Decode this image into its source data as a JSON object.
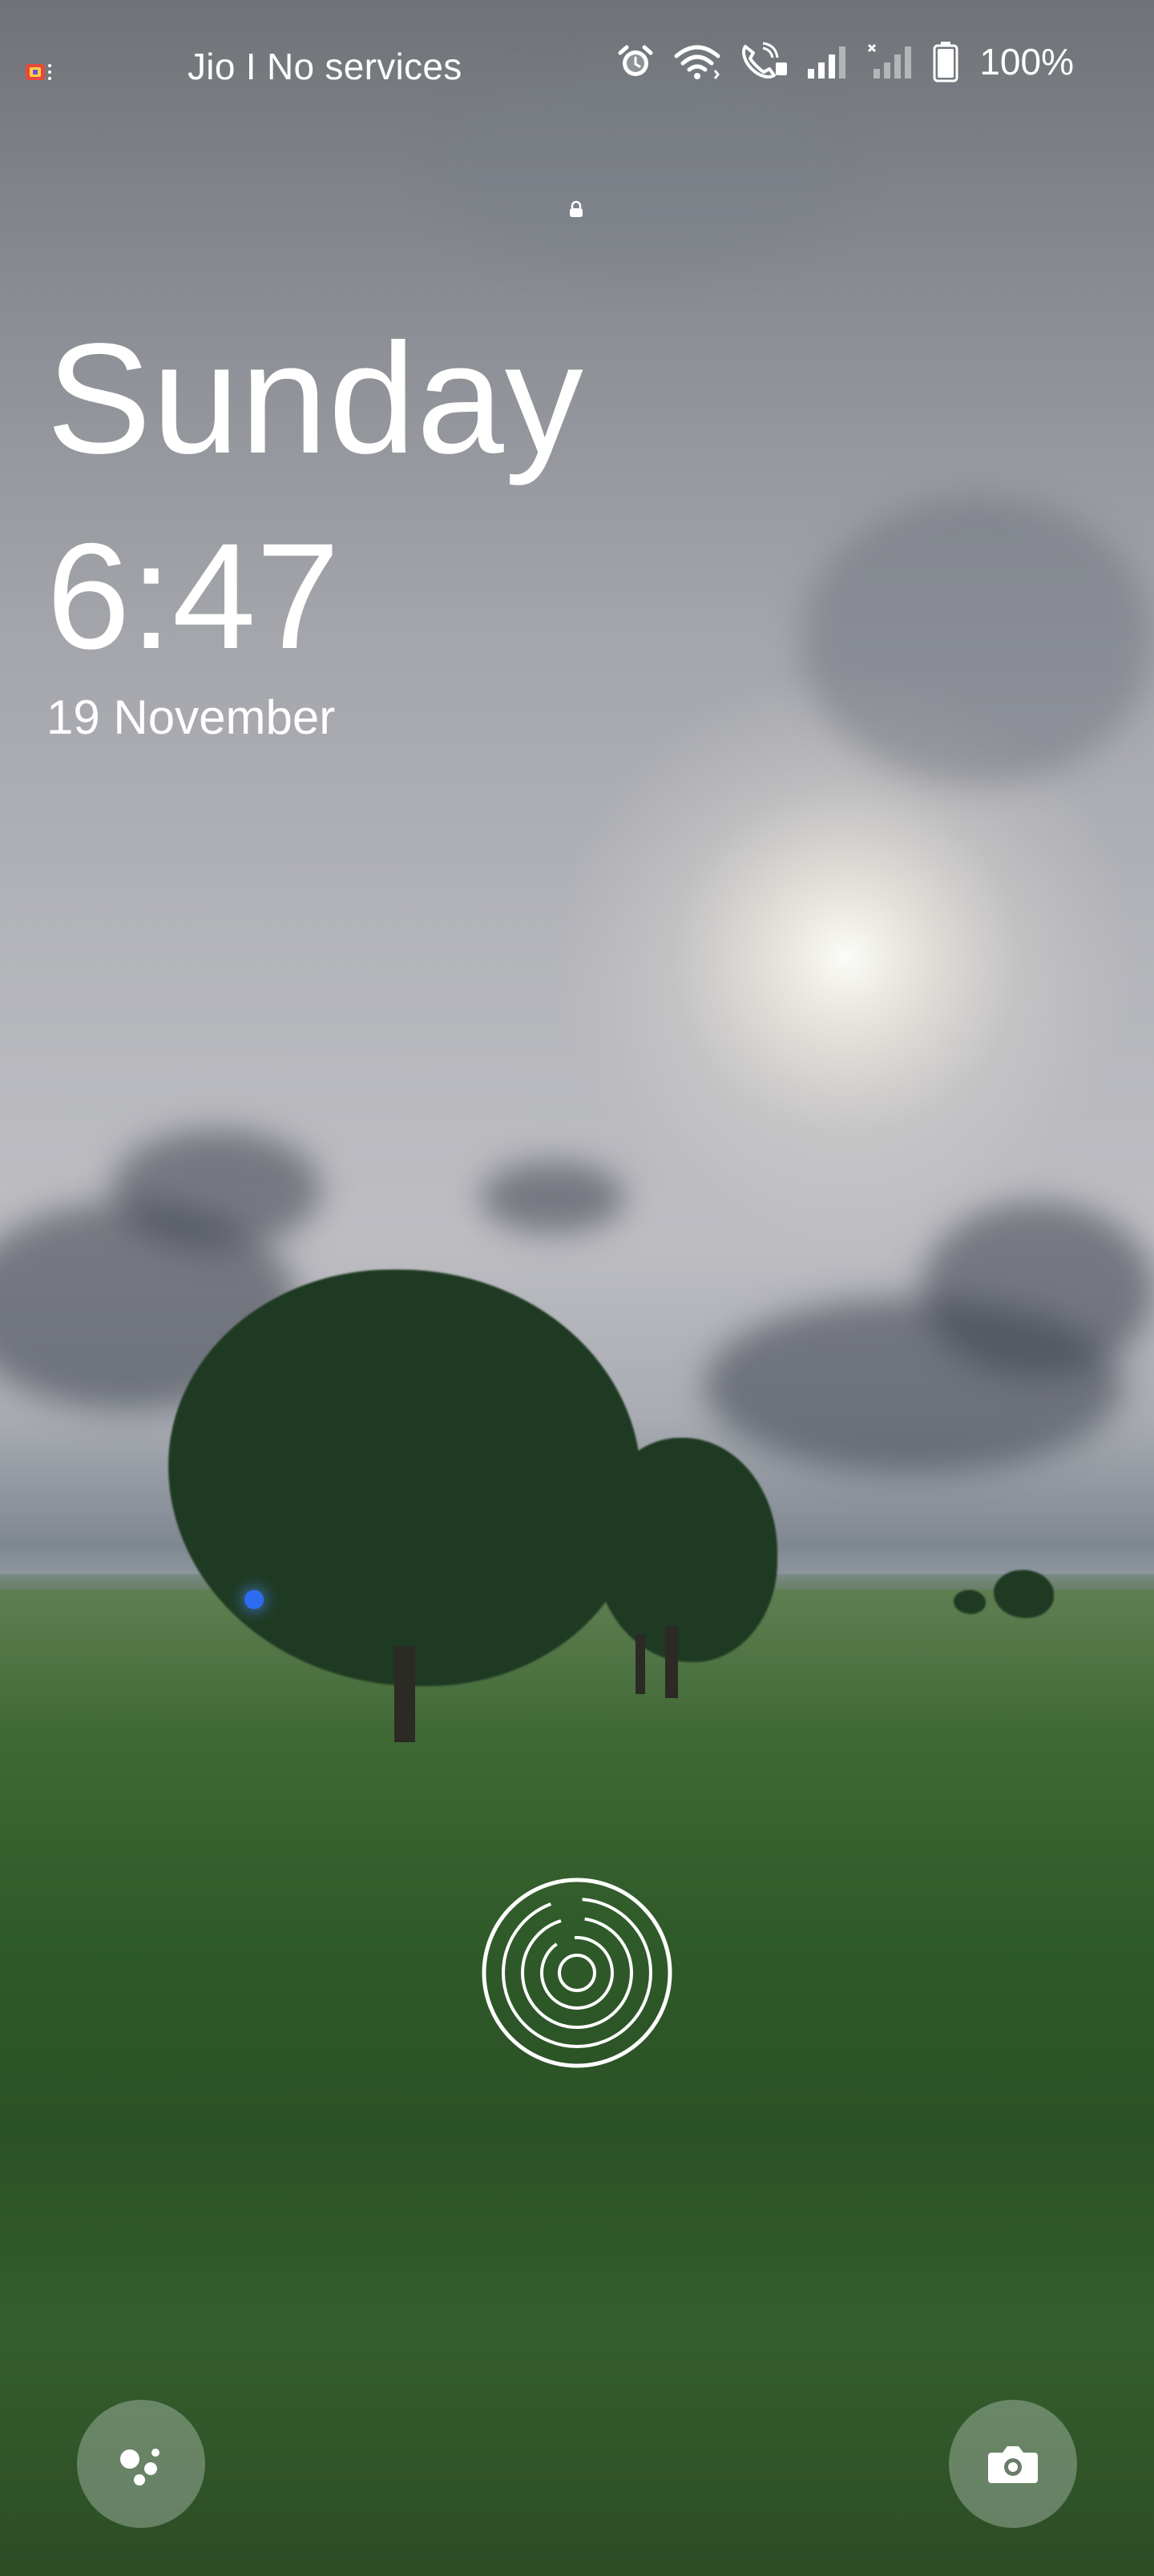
{
  "status_bar": {
    "carrier": "Jio I No services",
    "battery_percent": "100%",
    "icons": [
      "app-notification-icon",
      "alarm-icon",
      "wifi-icon",
      "volte-call-icon",
      "signal-icon",
      "signal-no-service-icon",
      "battery-icon"
    ]
  },
  "lockscreen": {
    "day": "Sunday",
    "time": "6:47",
    "date": "19 November"
  },
  "shortcuts": {
    "left": "assistant-icon",
    "right": "camera-icon"
  },
  "colors": {
    "text": "#ffffff",
    "sky": "#b5b6bb",
    "field": "#2f5a29"
  }
}
